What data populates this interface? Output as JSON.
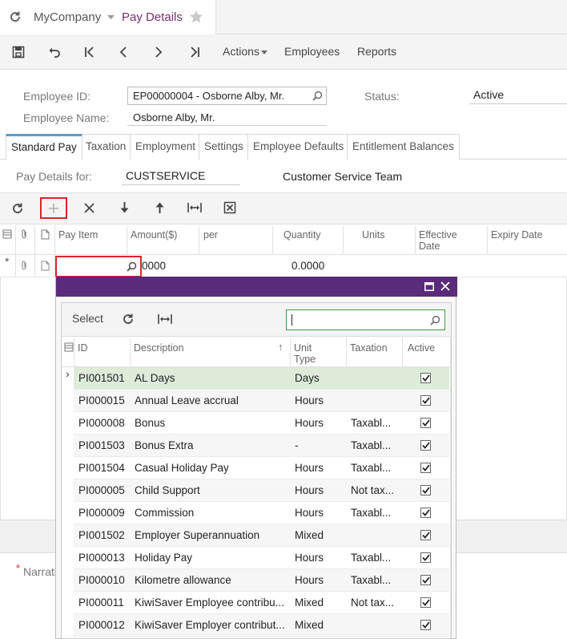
{
  "app": {
    "company": "MyCompany",
    "screen_title": "Pay Details"
  },
  "toolbar": {
    "actions_label": "Actions",
    "employees_label": "Employees",
    "reports_label": "Reports"
  },
  "header": {
    "employee_id_label": "Employee ID:",
    "employee_id_value": "EP00000004 - Osborne Alby, Mr.",
    "employee_name_label": "Employee Name:",
    "employee_name_value": "Osborne Alby, Mr.",
    "status_label": "Status:",
    "status_value": "Active"
  },
  "tabs": [
    "Standard Pay",
    "Taxation",
    "Employment",
    "Settings",
    "Employee Defaults",
    "Entitlement Balances"
  ],
  "pay_details": {
    "label": "Pay Details for:",
    "code": "CUSTSERVICE",
    "description": "Customer Service Team"
  },
  "grid": {
    "columns": {
      "pay_item": "Pay Item",
      "amount": "Amount($)",
      "per": "per",
      "quantity": "Quantity",
      "units": "Units",
      "effective_date_1": "Effective",
      "effective_date_2": "Date",
      "expiry_date": "Expiry Date"
    },
    "new_row": {
      "marker": "*",
      "amount": "0000",
      "quantity": "0.0000"
    }
  },
  "bottom": {
    "required_marker": "*",
    "narration_label": "Narrati"
  },
  "popup": {
    "select_label": "Select",
    "search_value": "",
    "columns": {
      "id": "ID",
      "description": "Description",
      "sort_indicator": "↑",
      "unit_type_1": "Unit",
      "unit_type_2": "Type",
      "taxation": "Taxation",
      "active": "Active"
    },
    "current_row_marker": "›",
    "rows": [
      {
        "id": "PI001501",
        "description": "AL Days",
        "unit_type": "Days",
        "taxation": "",
        "active": true
      },
      {
        "id": "PI000015",
        "description": "Annual Leave accrual",
        "unit_type": "Hours",
        "taxation": "",
        "active": true
      },
      {
        "id": "PI000008",
        "description": "Bonus",
        "unit_type": "Hours",
        "taxation": "Taxabl...",
        "active": true
      },
      {
        "id": "PI001503",
        "description": "Bonus Extra",
        "unit_type": "-",
        "taxation": "Taxabl...",
        "active": true
      },
      {
        "id": "PI001504",
        "description": "Casual Holiday Pay",
        "unit_type": "Hours",
        "taxation": "Taxabl...",
        "active": true
      },
      {
        "id": "PI000005",
        "description": "Child Support",
        "unit_type": "Hours",
        "taxation": "Not tax...",
        "active": true
      },
      {
        "id": "PI000009",
        "description": "Commission",
        "unit_type": "Hours",
        "taxation": "Taxabl...",
        "active": true
      },
      {
        "id": "PI001502",
        "description": "Employer Superannuation",
        "unit_type": "Mixed",
        "taxation": "",
        "active": true
      },
      {
        "id": "PI000013",
        "description": "Holiday Pay",
        "unit_type": "Hours",
        "taxation": "Taxabl...",
        "active": true
      },
      {
        "id": "PI000010",
        "description": "Kilometre allowance",
        "unit_type": "Hours",
        "taxation": "Taxabl...",
        "active": true
      },
      {
        "id": "PI000011",
        "description": "KiwiSaver Employee contribu...",
        "unit_type": "Mixed",
        "taxation": "Not tax...",
        "active": true
      },
      {
        "id": "PI000012",
        "description": "KiwiSaver Employer contribut...",
        "unit_type": "Mixed",
        "taxation": "",
        "active": true
      }
    ]
  },
  "colors": {
    "accent_purple": "#5a2b7a",
    "title_purple": "#7b2d6c",
    "selected_row": "#dcecd9",
    "error_red": "#d9262b",
    "search_green": "#3d9a3d"
  }
}
